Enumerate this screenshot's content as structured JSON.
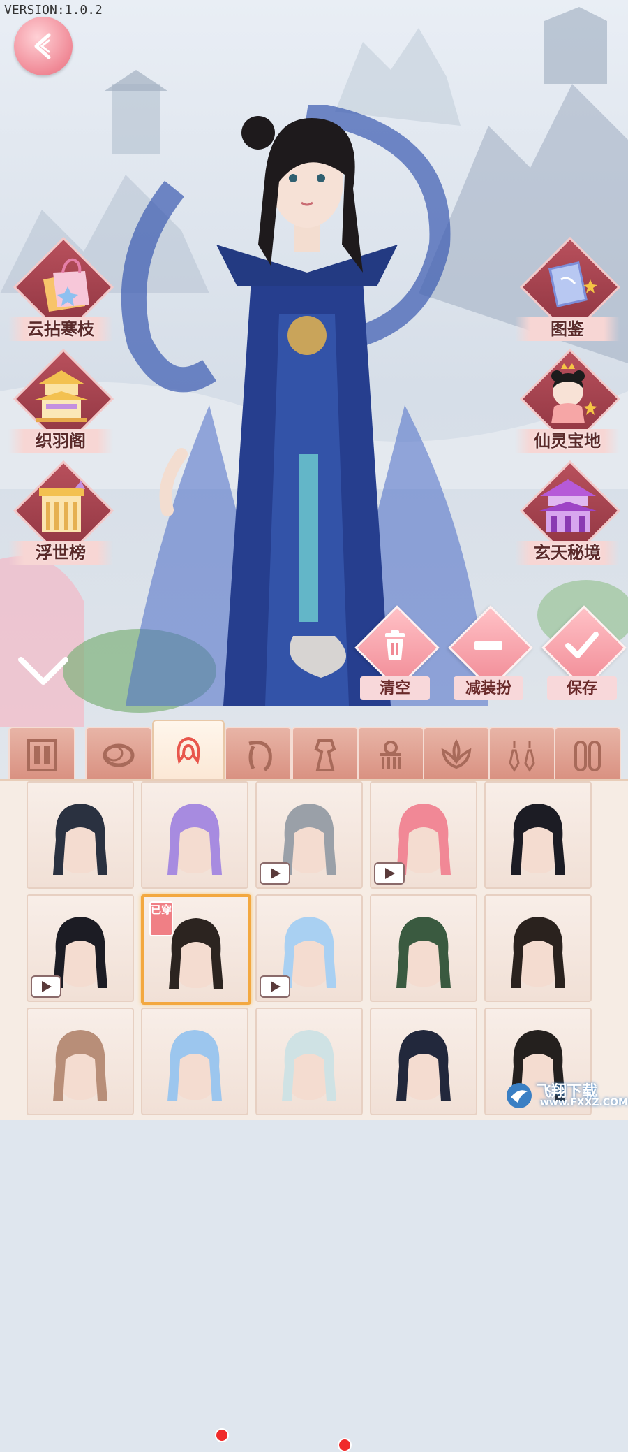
{
  "version": "VERSION:1.0.2",
  "left_menu": [
    {
      "label": "云拈寒枝",
      "icon": "shopping-bag-icon"
    },
    {
      "label": "织羽阁",
      "icon": "pavilion-icon"
    },
    {
      "label": "浮世榜",
      "icon": "ranking-gate-icon"
    }
  ],
  "right_menu": [
    {
      "label": "图鉴",
      "icon": "album-book-icon"
    },
    {
      "label": "仙灵宝地",
      "icon": "spirit-doll-icon"
    },
    {
      "label": "玄天秘境",
      "icon": "purple-palace-icon"
    }
  ],
  "actions": {
    "clear": "清空",
    "reduce": "减装扮",
    "save": "保存"
  },
  "tabs": [
    {
      "icon": "wardrobe-icon",
      "active": false,
      "dot": false
    },
    {
      "icon": "bracelet-icon",
      "active": false,
      "dot": false
    },
    {
      "icon": "hair-icon",
      "active": true,
      "dot": true
    },
    {
      "icon": "hairstyle-long-icon",
      "active": false,
      "dot": false
    },
    {
      "icon": "dress-icon",
      "active": false,
      "dot": true
    },
    {
      "icon": "hair-ornament-icon",
      "active": false,
      "dot": false
    },
    {
      "icon": "lotus-accessory-icon",
      "active": false,
      "dot": false
    },
    {
      "icon": "earrings-icon",
      "active": false,
      "dot": false
    },
    {
      "icon": "shoes-icon",
      "active": false,
      "dot": false
    }
  ],
  "worn_tag": "已穿",
  "hair_items": [
    {
      "color": "#2a3140",
      "video": false,
      "worn": false
    },
    {
      "color": "#a78be0",
      "video": false,
      "worn": false
    },
    {
      "color": "#9aa0a8",
      "video": true,
      "worn": false
    },
    {
      "color": "#f18896",
      "video": true,
      "worn": false
    },
    {
      "color": "#1c1c24",
      "video": false,
      "worn": false
    },
    {
      "color": "#1c1c24",
      "video": true,
      "worn": false
    },
    {
      "color": "#2c2420",
      "video": false,
      "worn": true
    },
    {
      "color": "#a9d0f2",
      "video": true,
      "worn": false
    },
    {
      "color": "#3a5a40",
      "video": false,
      "worn": false
    },
    {
      "color": "#2a221e",
      "video": false,
      "worn": false
    },
    {
      "color": "#b88e78",
      "video": false,
      "worn": false
    },
    {
      "color": "#9cc6ee",
      "video": false,
      "worn": false
    },
    {
      "color": "#cfe2e4",
      "video": false,
      "worn": false
    },
    {
      "color": "#22283c",
      "video": false,
      "worn": false
    },
    {
      "color": "#24201e",
      "video": false,
      "worn": false
    }
  ],
  "watermark": {
    "cn": "飞翔下载",
    "en": "www.FXXZ.COM"
  }
}
